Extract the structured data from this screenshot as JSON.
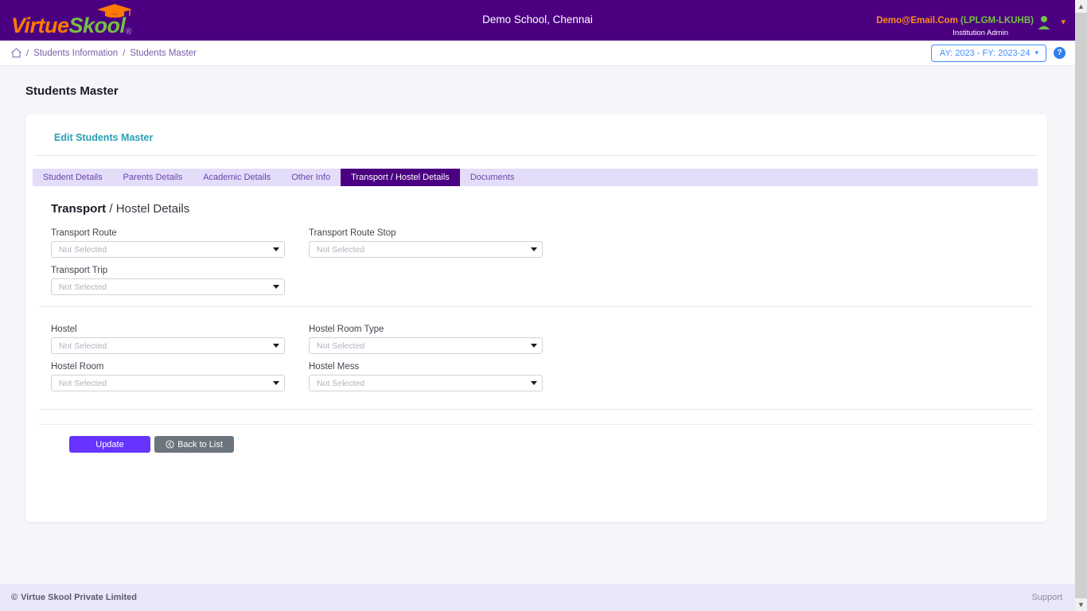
{
  "header": {
    "logo": {
      "part1": "Virtue",
      "part2": "Skool",
      "registered": "®",
      "cap_icon": "graduation-cap-icon"
    },
    "school_name": "Demo School, Chennai",
    "user_email": "Demo@Email.Com",
    "user_code": "(LPLGM-LKUHB)",
    "user_role": "Institution Admin",
    "avatar_icon": "user-avatar-icon",
    "caret_icon": "chevron-down-icon"
  },
  "breadcrumb": {
    "home_icon": "home-icon",
    "sep": "/",
    "items": [
      {
        "label": "Students Information"
      },
      {
        "label": "Students Master"
      }
    ],
    "academic_year": "AY: 2023 - FY: 2023-24",
    "ay_caret": "chevron-down-icon",
    "help_label": "?"
  },
  "page": {
    "title": "Students Master",
    "edit_link": "Edit Students Master"
  },
  "tabs": [
    {
      "label": "Student Details",
      "active": false
    },
    {
      "label": "Parents Details",
      "active": false
    },
    {
      "label": "Academic Details",
      "active": false
    },
    {
      "label": "Other Info",
      "active": false
    },
    {
      "label": "Transport / Hostel Details",
      "active": true
    },
    {
      "label": "Documents",
      "active": false
    }
  ],
  "section": {
    "title_bold": "Transport",
    "title_rest": " / Hostel Details"
  },
  "transport_fields": [
    {
      "label": "Transport Route",
      "value": "Not Selected"
    },
    {
      "label": "Transport Route Stop",
      "value": "Not Selected"
    },
    {
      "label": "Transport Trip",
      "value": "Not Selected"
    }
  ],
  "hostel_fields": [
    {
      "label": "Hostel",
      "value": "Not Selected"
    },
    {
      "label": "Hostel Room Type",
      "value": "Not Selected"
    },
    {
      "label": "Hostel Room",
      "value": "Not Selected"
    },
    {
      "label": "Hostel Mess",
      "value": "Not Selected"
    }
  ],
  "buttons": {
    "update": "Update",
    "back": "Back to List",
    "back_icon": "back-circle-arrow-icon"
  },
  "footer": {
    "copyright_mark": "©",
    "copyright": "Virtue Skool Private Limited",
    "support": "Support"
  },
  "colors": {
    "brand_purple": "#4b0082",
    "logo_orange": "#ff7a00",
    "logo_green": "#76c043",
    "tab_strip": "#e3ddfa",
    "accent_blue": "#3d8bfd",
    "teal_link": "#28a0b5",
    "update_violet": "#6633ff",
    "back_gray": "#6c757d",
    "footer_bg": "#eae7f8"
  }
}
